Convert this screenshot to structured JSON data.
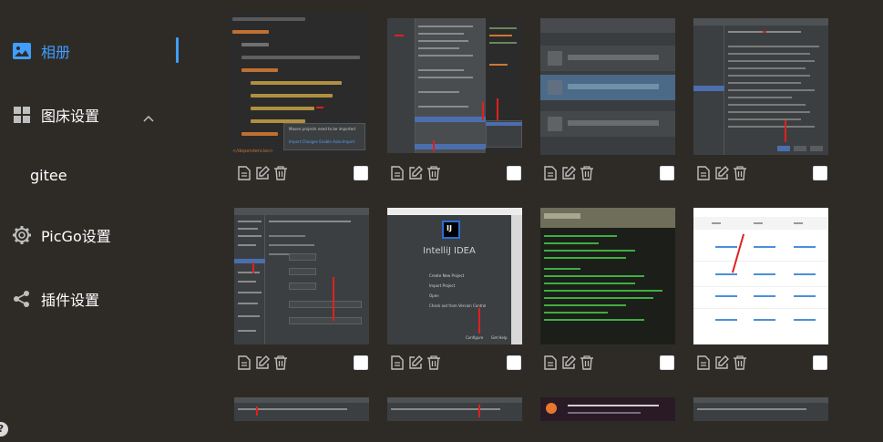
{
  "sidebar": {
    "items": [
      {
        "label": "相册",
        "icon": "image-icon",
        "active": true
      },
      {
        "label": "图床设置",
        "icon": "grid-icon",
        "expanded": true
      },
      {
        "label": "gitee",
        "icon": null,
        "sub": true
      },
      {
        "label": "PicGo设置",
        "icon": "gear-icon"
      },
      {
        "label": "插件设置",
        "icon": "share-icon"
      }
    ],
    "help": "?"
  },
  "gallery": {
    "thumb_texts": {
      "t1_line1": "Maven projects need to be imported",
      "t1_line2": "Import Changes   Enable Auto-Import",
      "t1_bottom": "</dependencies>",
      "t6_title": "IntelliJ IDEA",
      "t6_logo": "IJ",
      "t6_item1": "Create New Project",
      "t6_item2": "Import Project",
      "t6_item3": "Open",
      "t6_item4": "Check out from Version Control",
      "t6_configure": "Configure",
      "t6_help": "Get Help"
    }
  },
  "colors": {
    "background": "#2e2b27",
    "accent": "#409eff",
    "text": "#ffffff",
    "checkbox": "#ffffff"
  }
}
